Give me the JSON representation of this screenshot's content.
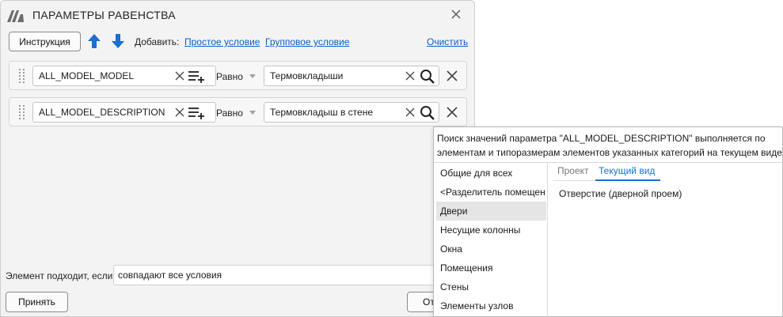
{
  "dialog": {
    "title": "ПАРАМЕТРЫ РАВЕНСТВА",
    "toolbar": {
      "instruction_label": "Инструкция",
      "add_label": "Добавить:",
      "simple_condition_link": "Простое условие",
      "group_condition_link": "Групповое условие",
      "clear_link": "Очистить"
    },
    "conditions": [
      {
        "parameter": "ALL_MODEL_MODEL",
        "operator": "Равно",
        "value": "Термовкладыши"
      },
      {
        "parameter": "ALL_MODEL_DESCRIPTION",
        "operator": "Равно",
        "value": "Термовкладыш в стене"
      }
    ],
    "footer": {
      "match_label": "Элемент подходит, если",
      "match_value": "совпадают все условия",
      "accept_label": "Принять",
      "cancel_label_partial": "От"
    }
  },
  "popup": {
    "info": "Поиск значений параметра \"ALL_MODEL_DESCRIPTION\" выполняется по элементам и типоразмерам элементов указанных категорий на текущем виде",
    "categories": [
      "Общие для всех",
      "<Разделитель помещен",
      "Двери",
      "Несущие колонны",
      "Окна",
      "Помещения",
      "Стены",
      "Элементы узлов"
    ],
    "selected_category": "Двери",
    "tabs": [
      "Проект",
      "Текущий вид"
    ],
    "active_tab": "Текущий вид",
    "values": [
      "Отверстие (дверной проем)"
    ]
  },
  "colors": {
    "accent": "#1a6fd1",
    "link": "#0b5fc6",
    "selected_row": "#e5e5e5"
  }
}
